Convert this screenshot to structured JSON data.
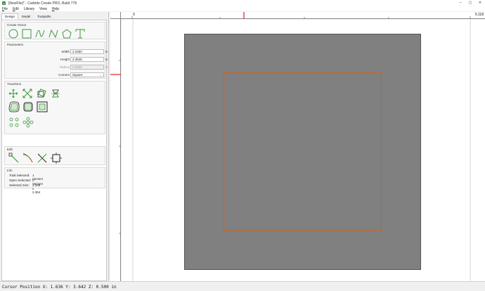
{
  "window": {
    "title": "[NewFile]* - Carbide Create PRO, Build 778",
    "controls": {
      "minimize": "–",
      "maximize": "▢",
      "close": "✕"
    }
  },
  "menu": {
    "file": {
      "u": "F",
      "rest": "ile"
    },
    "edit": {
      "u": "E",
      "rest": "dit"
    },
    "library": {
      "u": "",
      "rest": "Library"
    },
    "view": {
      "u": "",
      "rest": "View"
    },
    "help": {
      "u": "H",
      "rest": "elp"
    }
  },
  "tabs": [
    {
      "label": "Design",
      "active": true
    },
    {
      "label": "Model",
      "active": false
    },
    {
      "label": "Toolpaths",
      "active": false
    }
  ],
  "create_vector": {
    "title": "Create Vector",
    "tools": [
      "circle-icon",
      "rectangle-icon",
      "curve-icon",
      "polyline-icon",
      "polygon-icon",
      "text-icon"
    ]
  },
  "parameters": {
    "title": "Parameters",
    "width": {
      "label": "Width",
      "value": "2.3450",
      "unit": "in"
    },
    "height": {
      "label": "Height",
      "value": "2.3545",
      "unit": "in"
    },
    "radius": {
      "label": "Radius",
      "value": "0.2500",
      "unit": "in"
    },
    "corners": {
      "label": "Corners",
      "value": "Square"
    }
  },
  "transform": {
    "title": "Transform",
    "tools": [
      "move-icon",
      "scale-icon",
      "rotate-icon",
      "mirror-icon",
      "offset-icon",
      "fillet-icon",
      "boolean-icon",
      "align-icon",
      "array-icon"
    ]
  },
  "edit": {
    "title": "Edit",
    "tools": [
      "node-edit-icon",
      "trim-icon",
      "cut-icon",
      "bounding-box-icon"
    ]
  },
  "info": {
    "title": "Info",
    "total_selected": {
      "label": "Total Selected:",
      "value": "1 Vectors"
    },
    "open_selected": {
      "label": "Open Selected:",
      "value": "0 Vectors"
    },
    "selected_size": {
      "label": "Selected Size:",
      "value": "2.345 x 2.354"
    }
  },
  "ruler": {
    "start_label": "0",
    "end_label": "5.118"
  },
  "status": {
    "cursor": "Cursor Position X: 1.636 Y: 3.642 Z: 0.500 in"
  },
  "colors": {
    "accent_green": "#3a9a3a",
    "vector_orange": "#c4652b",
    "stock_gray": "#808080",
    "ruler_marker": "#e02020"
  }
}
